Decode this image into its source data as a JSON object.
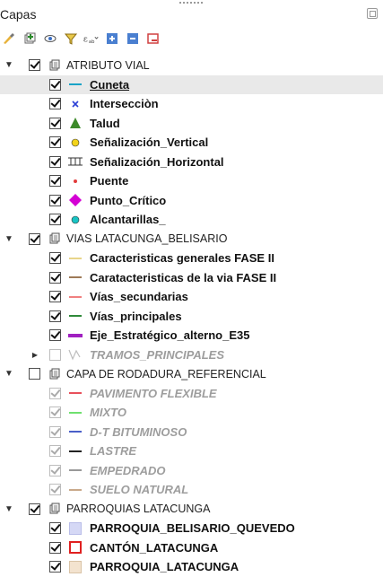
{
  "panel": {
    "title": "Capas"
  },
  "toolbar": {
    "buttons": [
      {
        "name": "style-brush-icon",
        "label": "Open layer styling"
      },
      {
        "name": "add-group-icon",
        "label": "Add group"
      },
      {
        "name": "manage-visibility-icon",
        "label": "Manage map themes"
      },
      {
        "name": "filter-legend-icon",
        "label": "Filter legend"
      },
      {
        "name": "filter-expression-icon",
        "label": "Filter by expression"
      },
      {
        "name": "expand-all-icon",
        "label": "Expand all"
      },
      {
        "name": "collapse-all-icon",
        "label": "Collapse all"
      },
      {
        "name": "remove-layer-icon",
        "label": "Remove layer"
      }
    ]
  },
  "colors": {
    "selected_row": "#e9e9e9",
    "unchecked_gray": "#9d9d9d",
    "accent_cyan": "#1aa3c7",
    "magenta": "#d400d4"
  },
  "tree": [
    {
      "label": "ATRIBUTO VIAL",
      "kind": "group",
      "expanded": true,
      "checked": true,
      "indent": 0
    },
    {
      "label": "Cuneta",
      "kind": "layer",
      "checked": true,
      "indent": 1,
      "symbol": "line",
      "color": "#1aa3c7",
      "selected": true,
      "underline": true
    },
    {
      "label": "Intersecciòn",
      "kind": "layer",
      "checked": true,
      "indent": 1,
      "symbol": "cross",
      "color": "#2b3fd6"
    },
    {
      "label": "Talud",
      "kind": "layer",
      "checked": true,
      "indent": 1,
      "symbol": "triangle",
      "color": "#3d8a2a"
    },
    {
      "label": "Señalización_Vertical",
      "kind": "layer",
      "checked": true,
      "indent": 1,
      "symbol": "circle",
      "color": "#f2d31a"
    },
    {
      "label": "Señalización_Horizontal",
      "kind": "layer",
      "checked": true,
      "indent": 1,
      "symbol": "hbars",
      "color": "#333333"
    },
    {
      "label": "Puente",
      "kind": "layer",
      "checked": true,
      "indent": 1,
      "symbol": "dot",
      "color": "#e23b3b"
    },
    {
      "label": "Punto_Crítico",
      "kind": "layer",
      "checked": true,
      "indent": 1,
      "symbol": "diamond",
      "color": "#d400d4"
    },
    {
      "label": "Alcantarillas_",
      "kind": "layer",
      "checked": true,
      "indent": 1,
      "symbol": "circle",
      "color": "#19c4c4"
    },
    {
      "label": "VIAS LATACUNGA_BELISARIO",
      "kind": "group",
      "expanded": true,
      "checked": true,
      "indent": 0
    },
    {
      "label": "Caracteristicas generales FASE II",
      "kind": "layer",
      "checked": true,
      "indent": 1,
      "symbol": "line",
      "color": "#e8d58a"
    },
    {
      "label": "Caratacteristicas de la via FASE II",
      "kind": "layer",
      "checked": true,
      "indent": 1,
      "symbol": "line",
      "color": "#9e7a58"
    },
    {
      "label": "Vías_secundarias",
      "kind": "layer",
      "checked": true,
      "indent": 1,
      "symbol": "line",
      "color": "#f08080"
    },
    {
      "label": "Vías_principales",
      "kind": "layer",
      "checked": true,
      "indent": 1,
      "symbol": "line",
      "color": "#2f8a3a"
    },
    {
      "label": "Eje_Estratégico_alterno_E35",
      "kind": "layer",
      "checked": true,
      "indent": 1,
      "symbol": "thickline",
      "color": "#a020c0"
    },
    {
      "label": "TRAMOS_PRINCIPALES",
      "kind": "layer",
      "checked": false,
      "indent": 1,
      "symbol": "polyline",
      "color": "#bdbdbd",
      "collapsed_arrow": true,
      "italic": true,
      "gray": true
    },
    {
      "label": "CAPA DE RODADURA_REFERENCIAL",
      "kind": "group",
      "expanded": true,
      "checked": false,
      "indent": 0
    },
    {
      "label": "PAVIMENTO FLEXIBLE",
      "kind": "layer",
      "checked": true,
      "dim": true,
      "indent": 1,
      "symbol": "line",
      "color": "#e8505b",
      "italic": true,
      "gray": true
    },
    {
      "label": "MIXTO",
      "kind": "layer",
      "checked": true,
      "dim": true,
      "indent": 1,
      "symbol": "line",
      "color": "#6fe06f",
      "italic": true,
      "gray": true
    },
    {
      "label": "D-T BITUMINOSO",
      "kind": "layer",
      "checked": true,
      "dim": true,
      "indent": 1,
      "symbol": "line",
      "color": "#4a5fc8",
      "italic": true,
      "gray": true
    },
    {
      "label": "LASTRE",
      "kind": "layer",
      "checked": true,
      "dim": true,
      "indent": 1,
      "symbol": "line",
      "color": "#222222",
      "italic": true,
      "gray": true
    },
    {
      "label": "EMPEDRADO",
      "kind": "layer",
      "checked": true,
      "dim": true,
      "indent": 1,
      "symbol": "line",
      "color": "#999999",
      "italic": true,
      "gray": true
    },
    {
      "label": "SUELO NATURAL",
      "kind": "layer",
      "checked": true,
      "dim": true,
      "indent": 1,
      "symbol": "line",
      "color": "#c9a98a",
      "italic": true,
      "gray": true
    },
    {
      "label": "PARROQUIAS LATACUNGA",
      "kind": "group",
      "expanded": true,
      "checked": true,
      "indent": 0
    },
    {
      "label": "PARROQUIA_BELISARIO_QUEVEDO",
      "kind": "layer",
      "checked": true,
      "indent": 1,
      "symbol": "fill",
      "color": "#d5d8f5",
      "border": "#b9bde8"
    },
    {
      "label": "CANTÓN_LATACUNGA",
      "kind": "layer",
      "checked": true,
      "indent": 1,
      "symbol": "fill",
      "color": "#ffffff",
      "border": "#e02020"
    },
    {
      "label": "PARROQUIA_LATACUNGA",
      "kind": "layer",
      "checked": true,
      "indent": 1,
      "symbol": "fill",
      "color": "#f3e3cf",
      "border": "#d9c3a6"
    }
  ]
}
